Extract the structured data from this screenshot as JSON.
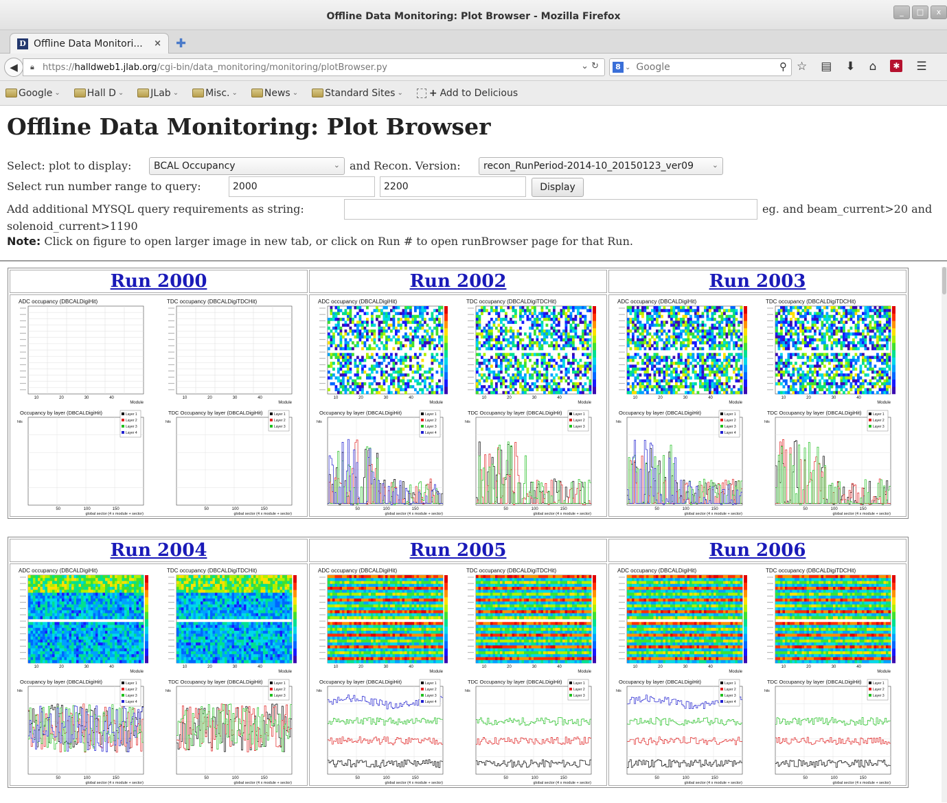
{
  "window": {
    "title": "Offline Data Monitoring: Plot Browser - Mozilla Firefox",
    "tab_title": "Offline Data Monitori...",
    "tab_close": "×",
    "favicon_letter": "D"
  },
  "navbar": {
    "url_prefix": "https://",
    "url_host": "halldweb1.jlab.org",
    "url_path": "/cgi-bin/data_monitoring/monitoring/plotBrowser.py",
    "search_placeholder": "Google",
    "search_engine_icon": "8"
  },
  "bookmarks": [
    {
      "label": "Google",
      "has_menu": true
    },
    {
      "label": "Hall D",
      "has_menu": true
    },
    {
      "label": "JLab",
      "has_menu": true
    },
    {
      "label": "Misc.",
      "has_menu": true
    },
    {
      "label": "News",
      "has_menu": true
    },
    {
      "label": "Standard Sites",
      "has_menu": true
    }
  ],
  "bookmark_delicious": "Add to Delicious",
  "page": {
    "title": "Offline Data Monitoring: Plot Browser",
    "select_plot_label": "Select: plot to display:",
    "plot_selected": "BCAL Occupancy",
    "recon_label": "and Recon. Version:",
    "recon_selected": "recon_RunPeriod-2014-10_20150123_ver09",
    "run_range_label": "Select run number range to query:",
    "run_min": "2000",
    "run_max": "2200",
    "display_button": "Display",
    "mysql_label": "Add additional MYSQL query requirements as string:",
    "mysql_value": "",
    "mysql_hint": "eg. and beam_current>20 and",
    "mysql_hint_cont": "solenoid_current>1190",
    "note_label": "Note:",
    "note_text": "Click on figure to open larger image in new tab, or click on Run # to open runBrowser page for that Run."
  },
  "plot_labels": {
    "adc_title": "ADC occupancy (DBCALDigiHit)",
    "tdc_title": "TDC occupancy (DBCALDigiTDCHit)",
    "occ_layer_title": "Occupancy by layer (DBCALDigiHit)",
    "tdc_layer_title": "TDC Occupancy by layer (DBCALDigiHit)",
    "module_axis": "Module",
    "sector_axis": "global sector  (4 x module + sector)",
    "hits_axis": "hits",
    "legend": [
      "Layer 1",
      "Layer 2",
      "Layer 3",
      "Layer 4"
    ]
  },
  "runs_row1": [
    {
      "label": "Run 2000",
      "mode": "empty"
    },
    {
      "label": "Run 2002",
      "mode": "sparse"
    },
    {
      "label": "Run 2003",
      "mode": "sparse2"
    }
  ],
  "runs_row2": [
    {
      "label": "Run 2004",
      "mode": "dense"
    },
    {
      "label": "Run 2005",
      "mode": "striped"
    },
    {
      "label": "Run 2006",
      "mode": "striped2"
    }
  ],
  "colors": {
    "link": "#1a1ab8",
    "layer1": "#000000",
    "layer2": "#e02020",
    "layer3": "#20c020",
    "layer4": "#2020d0"
  }
}
